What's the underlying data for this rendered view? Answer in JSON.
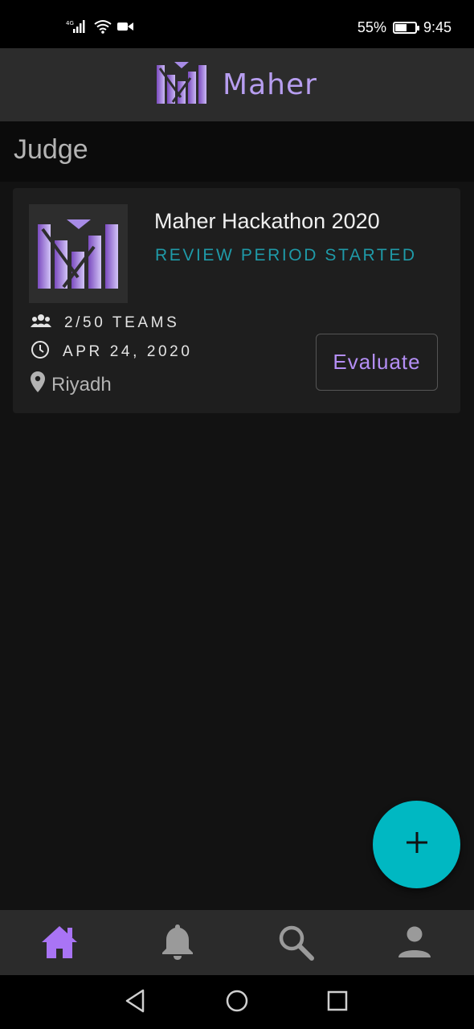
{
  "status_bar": {
    "network_label": "4G",
    "battery_percent": "55%",
    "battery_level": 0.55,
    "time": "9:45",
    "icons": [
      "signal-icon",
      "wifi-icon",
      "video-camera-icon",
      "battery-icon"
    ]
  },
  "app_bar": {
    "title": "Maher",
    "logo": "maher-logo"
  },
  "page": {
    "title": "Judge"
  },
  "event_card": {
    "title": "Maher Hackathon 2020",
    "status": "REVIEW PERIOD STARTED",
    "teams": "2/50 TEAMS",
    "date": "APR 24, 2020",
    "location": "Riyadh",
    "evaluate_label": "Evaluate",
    "status_color": "#1f9aa8",
    "accent_color": "#b48ef5"
  },
  "fab": {
    "icon": "plus-icon",
    "color": "#00b8c2"
  },
  "bottom_nav": {
    "items": [
      {
        "name": "home",
        "icon": "home-icon",
        "active": true
      },
      {
        "name": "notifications",
        "icon": "bell-icon",
        "active": false
      },
      {
        "name": "search",
        "icon": "search-icon",
        "active": false
      },
      {
        "name": "profile",
        "icon": "person-icon",
        "active": false
      }
    ],
    "active_color": "#a974f5",
    "inactive_color": "#9a9a9a"
  },
  "system_nav": {
    "buttons": [
      "back-icon",
      "home-circle-icon",
      "recents-icon"
    ]
  }
}
